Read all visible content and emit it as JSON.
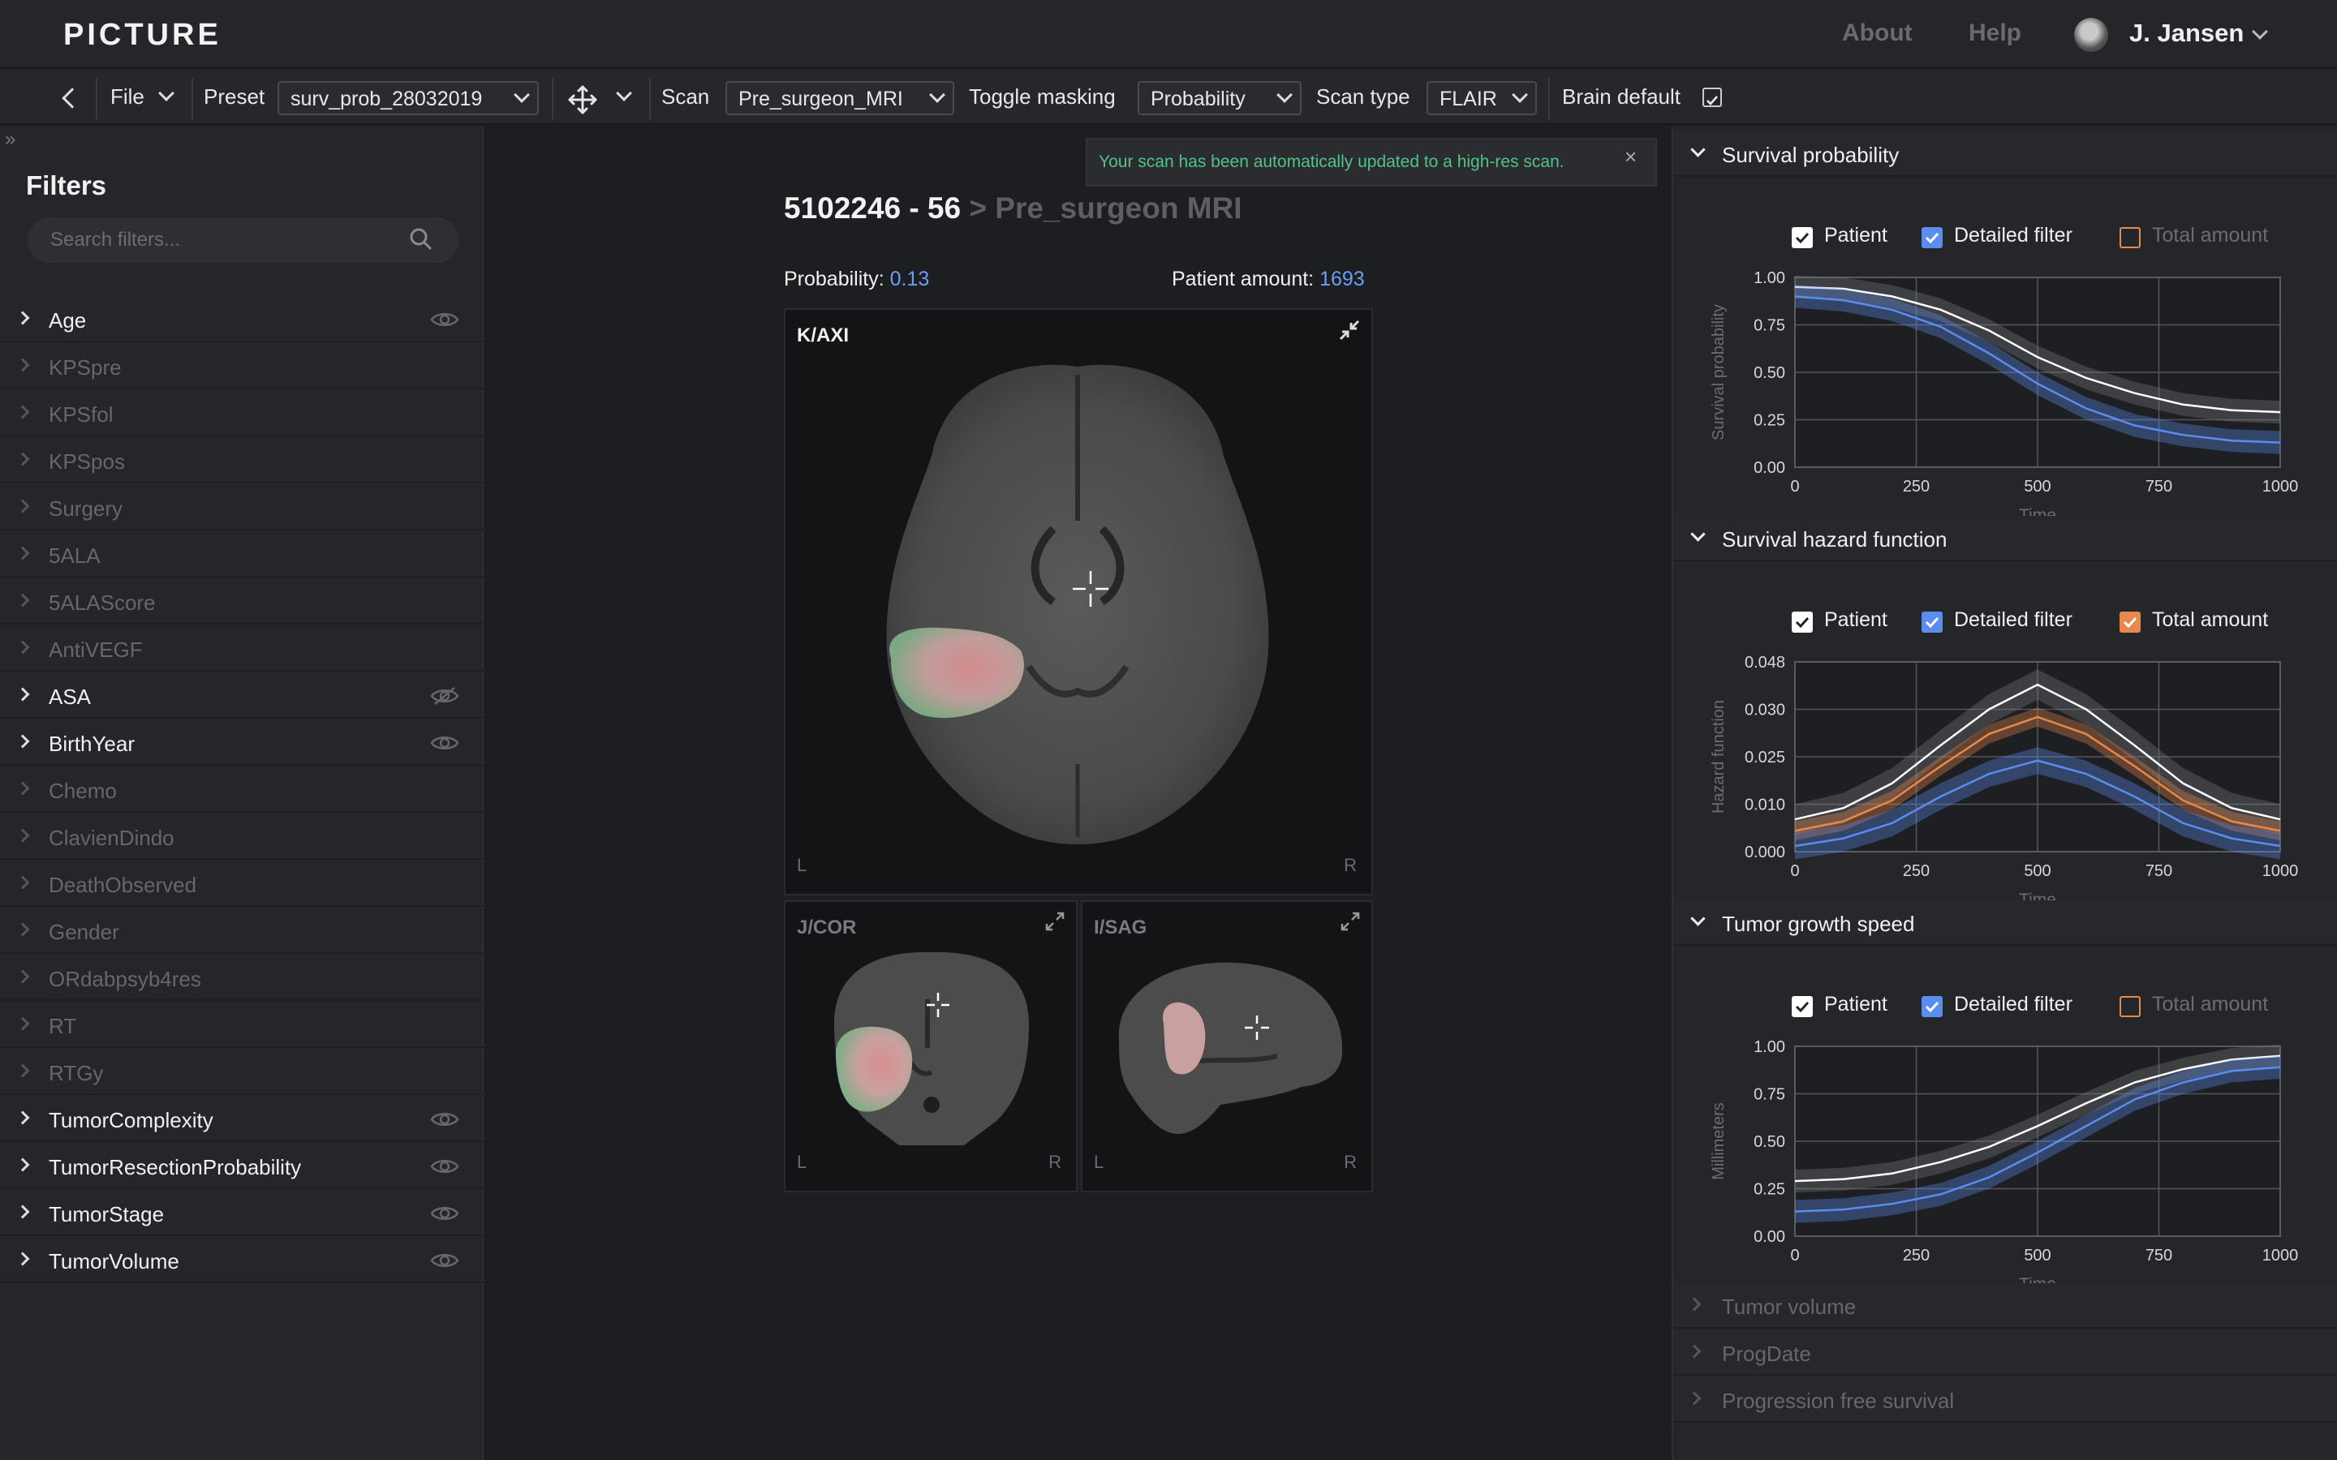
{
  "app": {
    "logo": "PICTURE",
    "nav": [
      {
        "label": "About"
      },
      {
        "label": "Help"
      }
    ],
    "user": {
      "name": "J. Jansen"
    }
  },
  "toolbar": {
    "file": "File",
    "preset_label": "Preset",
    "preset_value": "surv_prob_28032019",
    "scan_label": "Scan",
    "scan_value": "Pre_surgeon_MRI",
    "masking_label": "Toggle masking",
    "masking_value": "Probability",
    "scantype_label": "Scan type",
    "scantype_value": "FLAIR",
    "brain_default_label": "Brain default",
    "brain_default_checked": true
  },
  "filters": {
    "title": "Filters",
    "search_placeholder": "Search filters...",
    "items": [
      {
        "label": "Age",
        "active": true,
        "visibility": "visible"
      },
      {
        "label": "KPSpre",
        "active": false
      },
      {
        "label": "KPSfol",
        "active": false
      },
      {
        "label": "KPSpos",
        "active": false
      },
      {
        "label": "Surgery",
        "active": false
      },
      {
        "label": "5ALA",
        "active": false
      },
      {
        "label": "5ALAScore",
        "active": false
      },
      {
        "label": "AntiVEGF",
        "active": false
      },
      {
        "label": "ASA",
        "active": true,
        "visibility": "hidden"
      },
      {
        "label": "BirthYear",
        "active": true,
        "visibility": "visible"
      },
      {
        "label": "Chemo",
        "active": false
      },
      {
        "label": "ClavienDindo",
        "active": false
      },
      {
        "label": "DeathObserved",
        "active": false
      },
      {
        "label": "Gender",
        "active": false
      },
      {
        "label": "ORdabpsyb4res",
        "active": false
      },
      {
        "label": "RT",
        "active": false
      },
      {
        "label": "RTGy",
        "active": false
      },
      {
        "label": "TumorComplexity",
        "active": true,
        "visibility": "visible"
      },
      {
        "label": "TumorResectionProbability",
        "active": true,
        "visibility": "visible"
      },
      {
        "label": "TumorStage",
        "active": true,
        "visibility": "visible"
      },
      {
        "label": "TumorVolume",
        "active": true,
        "visibility": "visible"
      }
    ]
  },
  "main": {
    "toast": "Your scan has been automatically updated to a high-res scan.",
    "scan_id": "5102246 - 56",
    "scan_name": "> Pre_surgeon MRI",
    "probability_label": "Probability:",
    "probability_value": "0.13",
    "patient_amount_label": "Patient amount:",
    "patient_amount_value": "1693",
    "views": {
      "axial": {
        "label": "K/AXI",
        "left": "L",
        "right": "R"
      },
      "coronal": {
        "label": "J/COR",
        "left": "L",
        "right": "R"
      },
      "sagittal": {
        "label": "I/SAG",
        "left": "L",
        "right": "R"
      }
    }
  },
  "colors": {
    "patient": "#ffffff",
    "detailed": "#5b8def",
    "total": "#e8884a",
    "band": "#7a7b80"
  },
  "legend": {
    "patient": "Patient",
    "detailed": "Detailed filter",
    "total": "Total amount"
  },
  "sections": [
    {
      "title": "Survival probability",
      "expanded": true,
      "legend": {
        "patient": true,
        "detailed": true,
        "total": false
      }
    },
    {
      "title": "Survival hazard function",
      "expanded": true,
      "legend": {
        "patient": true,
        "detailed": true,
        "total": true
      }
    },
    {
      "title": "Tumor growth speed",
      "expanded": true,
      "legend": {
        "patient": true,
        "detailed": true,
        "total": false
      }
    },
    {
      "title": "Tumor volume",
      "expanded": false
    },
    {
      "title": "ProgDate",
      "expanded": false
    },
    {
      "title": "Progression free survival",
      "expanded": false
    }
  ],
  "chart_data": [
    {
      "type": "line",
      "xlabel": "Time",
      "ylabel": "Survival probability",
      "xticks": [
        "0",
        "250",
        "500",
        "750",
        "1000"
      ],
      "yticks": [
        "0.00",
        "0.25",
        "0.50",
        "0.75",
        "1.00"
      ],
      "xlim": [
        0,
        1000
      ],
      "ylim": [
        0,
        1
      ],
      "x": [
        0,
        100,
        200,
        300,
        400,
        500,
        600,
        700,
        800,
        900,
        1000
      ],
      "series": [
        {
          "name": "Patient",
          "values": [
            0.95,
            0.94,
            0.9,
            0.83,
            0.72,
            0.58,
            0.47,
            0.39,
            0.33,
            0.3,
            0.29
          ],
          "band": 0.06
        },
        {
          "name": "Detailed filter",
          "values": [
            0.9,
            0.88,
            0.83,
            0.74,
            0.6,
            0.44,
            0.31,
            0.22,
            0.17,
            0.14,
            0.13
          ],
          "band": 0.06
        }
      ]
    },
    {
      "type": "line",
      "xlabel": "Time",
      "ylabel": "Hazard function",
      "xticks": [
        "0",
        "250",
        "500",
        "750",
        "1000"
      ],
      "yticks": [
        "0.000",
        "0.010",
        "0.025",
        "0.030",
        "0.048"
      ],
      "xlim": [
        0,
        1000
      ],
      "ylim": [
        0,
        1
      ],
      "x": [
        0,
        100,
        200,
        300,
        400,
        500,
        600,
        700,
        800,
        900,
        1000
      ],
      "series": [
        {
          "name": "Patient",
          "values": [
            0.17,
            0.23,
            0.36,
            0.56,
            0.75,
            0.88,
            0.75,
            0.56,
            0.36,
            0.23,
            0.17
          ],
          "band": 0.08
        },
        {
          "name": "Total amount",
          "values": [
            0.11,
            0.16,
            0.27,
            0.45,
            0.62,
            0.71,
            0.62,
            0.45,
            0.27,
            0.16,
            0.11
          ],
          "band": 0.05
        },
        {
          "name": "Detailed filter",
          "values": [
            0.03,
            0.07,
            0.15,
            0.29,
            0.41,
            0.48,
            0.41,
            0.29,
            0.15,
            0.07,
            0.03
          ],
          "band": 0.07
        }
      ]
    },
    {
      "type": "line",
      "xlabel": "Time",
      "ylabel": "Millimeters",
      "xticks": [
        "0",
        "250",
        "500",
        "750",
        "1000"
      ],
      "yticks": [
        "0.00",
        "0.25",
        "0.50",
        "0.75",
        "1.00"
      ],
      "xlim": [
        0,
        1000
      ],
      "ylim": [
        0,
        1
      ],
      "x": [
        0,
        100,
        200,
        300,
        400,
        500,
        600,
        700,
        800,
        900,
        1000
      ],
      "series": [
        {
          "name": "Patient",
          "values": [
            0.29,
            0.3,
            0.33,
            0.39,
            0.47,
            0.58,
            0.7,
            0.81,
            0.88,
            0.93,
            0.95
          ],
          "band": 0.06
        },
        {
          "name": "Detailed filter",
          "values": [
            0.13,
            0.14,
            0.17,
            0.22,
            0.31,
            0.44,
            0.58,
            0.72,
            0.81,
            0.87,
            0.89
          ],
          "band": 0.06
        }
      ]
    }
  ]
}
